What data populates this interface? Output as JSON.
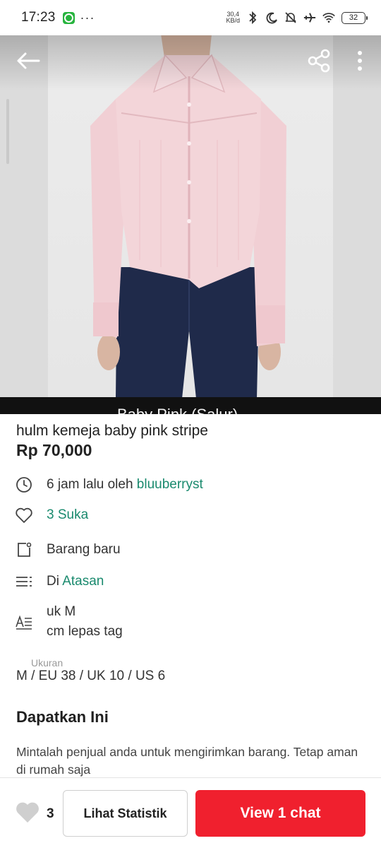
{
  "status_bar": {
    "time": "17:23",
    "net_speed_value": "30,4",
    "net_speed_unit": "KB/d",
    "battery": "32",
    "more_indicator": "···"
  },
  "hero": {
    "caption": "Baby Pink (Salur)",
    "icons": {
      "back": "arrow-left-icon",
      "share": "share-icon",
      "more": "more-vertical-icon"
    }
  },
  "product": {
    "title": "hulm kemeja baby pink stripe",
    "price": "Rp 70,000"
  },
  "details": {
    "posted_prefix": "6 jam lalu oleh ",
    "seller": "bluuberryst",
    "likes": "3 Suka",
    "condition": "Barang baru",
    "category_prefix": "Di ",
    "category": "Atasan",
    "desc_line1": "uk M",
    "desc_line2": "cm lepas tag",
    "size_label": "Ukuran",
    "size_value": "M / EU 38 / UK 10 / US 6"
  },
  "get_it": {
    "title": "Dapatkan Ini",
    "body": "Mintalah penjual anda untuk mengirimkan barang. Tetap aman di rumah saja"
  },
  "bottom_bar": {
    "like_count": "3",
    "stats_label": "Lihat Statistik",
    "chat_label": "View 1 chat"
  },
  "colors": {
    "accent": "#1a8a6e",
    "chat_button": "#f0202e",
    "shirt": "#f3d5d9",
    "jeans": "#1f2a4a"
  }
}
